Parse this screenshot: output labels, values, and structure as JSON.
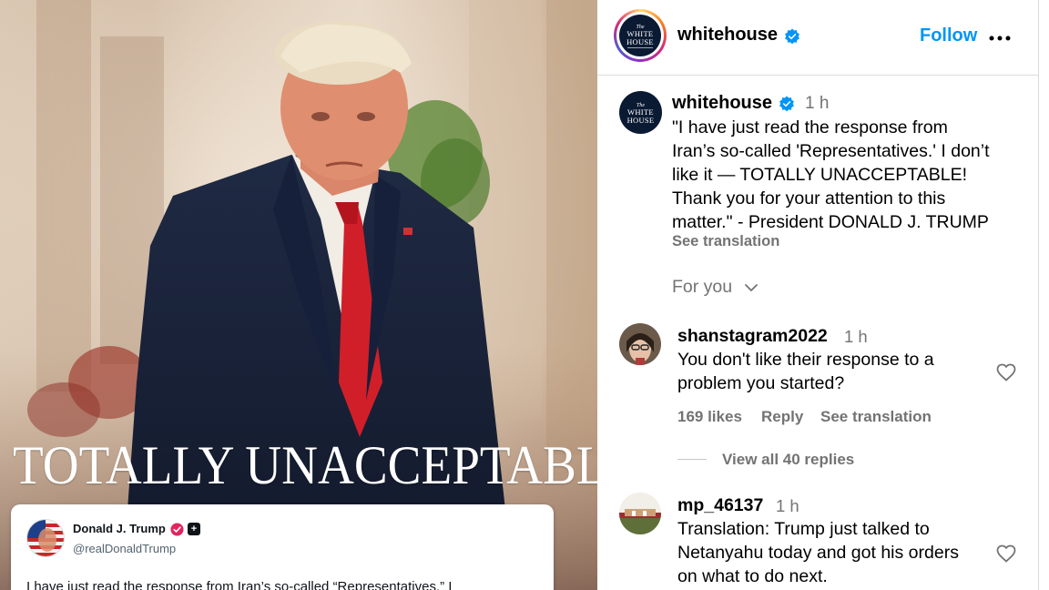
{
  "post_image": {
    "headline": "TOTALLY UNACCEPTABLE!",
    "tweet": {
      "name": "Donald J. Trump",
      "handle": "@realDonaldTrump",
      "text": "I have just read the response from Iran’s so-called “Representatives.” I"
    }
  },
  "header": {
    "username": "whitehouse",
    "follow_label": "Follow",
    "more_icon": "more-horizontal-icon",
    "logo": {
      "line1": "The",
      "line2": "WHITE",
      "line3": "HOUSE"
    }
  },
  "caption": {
    "username": "whitehouse",
    "time": "1 h",
    "lines": [
      "\"I have just read the response from",
      "Iran’s so-called 'Representatives.' I don’t",
      "like it — TOTALLY UNACCEPTABLE!",
      "Thank you for your attention to this",
      "matter.\" - President DONALD J. TRUMP"
    ],
    "see_translation": "See translation"
  },
  "sort": {
    "label": "For you"
  },
  "comments": [
    {
      "username": "shanstagram2022",
      "time": "1 h",
      "lines": [
        "You don't like their response to a",
        "problem you started?"
      ],
      "likes": "169 likes",
      "reply": "Reply",
      "see_translation": "See translation",
      "view_replies": "View all 40 replies"
    },
    {
      "username": "mp_46137",
      "time": "1 h",
      "lines": [
        "Translation: Trump just talked to",
        "Netanyahu today and got his orders",
        "on what to do next."
      ]
    }
  ],
  "colors": {
    "accent": "#0095f6",
    "secondary_text": "#737373",
    "verified": "#0095f6",
    "navy": "#0b1a33"
  }
}
